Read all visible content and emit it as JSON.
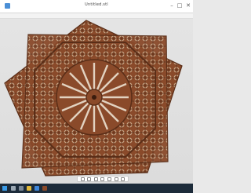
{
  "window": {
    "title": "Untitled.stl",
    "minimize_glyph": "–",
    "maximize_glyph": "□",
    "close_glyph": "✕"
  },
  "viewport": {
    "model_color": "#8a4a2a",
    "shadow_color": "#6e3a20"
  },
  "floating_toolbar": {
    "buttons": [
      "select-icon",
      "rotate-icon",
      "pan-icon",
      "zoom-icon",
      "fit-icon",
      "views-icon",
      "settings-icon"
    ]
  },
  "taskbar": {
    "icons": [
      "windows-start-icon",
      "search-icon",
      "taskview-icon",
      "explorer-icon",
      "browser-icon",
      "viewer-icon"
    ],
    "clock": ""
  }
}
